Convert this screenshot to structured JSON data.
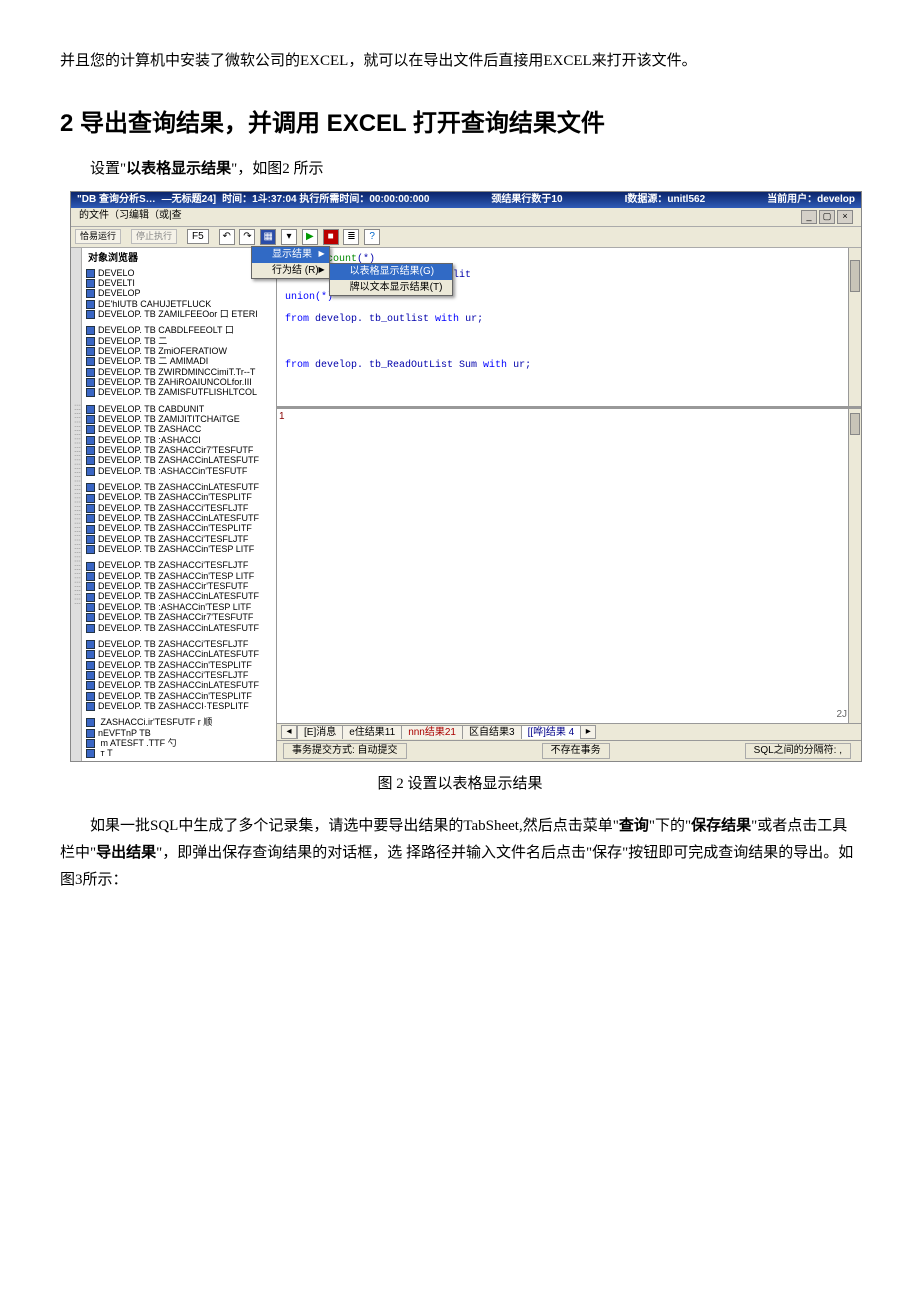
{
  "intro": "并且您的计算机中安装了微软公司的EXCEL，就可以在导出文件后直接用EXCEL来打开该文件。",
  "heading": "2 导出查询结果，并调用 EXCEL 打开查询结果文件",
  "lead_pre": "设置\"",
  "lead_bold": "以表格显示结果",
  "lead_post": "\"，如图2 所示",
  "figcap": "图 2 设置以表格显示结果",
  "outro_p1a": "如果一批SQL中生成了多个记录集，请选中要导出结果的TabSheet,然后点击菜单\"",
  "outro_b1": "查询",
  "outro_p1b": "\"下的\"",
  "outro_b2": "保存结果",
  "outro_p1c": "\"或者点击工具栏中\"",
  "outro_b3": "导出结果",
  "outro_p1d": "\"，即弹出保存查询结果的对话框，选 择路径并输入文件名后点击\"保存\"按钮即可完成查询结果的导出。如图3所示：",
  "titlebar": {
    "app": "\"DB 查询分析S…",
    "doc": "—无标题24]",
    "time": "时间：1斗:37:04 执行所需时间：00:00:00:000",
    "rows": "颈结果行数于10",
    "ds": "I数据源：unitl562",
    "user": "当前用户：develop"
  },
  "menubar": "的文件（习编辑（或|查",
  "toolbar": {
    "run": "恰易运行",
    "stop": "停止执行",
    "f5": "F5"
  },
  "objpane_title": "对象浏览器",
  "menu": {
    "m1": "显示结果",
    "m2": "行为结 (R)",
    "sub1": "以表格显示结果(G)",
    "sub2": "牌以文本显示结果(T)"
  },
  "sql": {
    "l1a": "select ",
    "l1b": "count",
    "l1c": "(*)",
    "l2": "from develop.tb_outlistforsplit",
    "l3": "union(*)",
    "l4a": "from ",
    "l4b": "develop. tb_outlist ",
    "l4c": "with ",
    "l4d": "ur;",
    "l5a": "from ",
    "l5b": "develop. tb_ReadOutList Sum ",
    "l5c": "with ",
    "l5d": "ur;"
  },
  "objlist": [
    "DEVELO",
    "DEVELTI",
    "DEVELOP",
    "DE'hIUTB       CAHUJETFLUCK",
    "DEVELOP. TB  ZAMILFEEOor 口  ETERI",
    "DEVELOP. TB  CABDLFEEOLT 口",
    "DEVELOP. TB  二",
    "DEVELOP. TB  ZmiOFERATIOW",
    "DEVELOP. TB  二 AMIMADI",
    "DEVELOP. TB  ZWIRDMINCCimiT.Tr--T",
    "DEVELOP. TB  ZAHiROAIUNCOLfor.III",
    "DEVELOP. TB  ZAMISFUTFLISHLTCOL",
    "DEVELOP. TB  CABDUNIT",
    "DEVELOP. TB  ZAMIJITITCHAiTGE",
    "DEVELOP. TB  ZASHACC",
    "DEVELOP. TB  :ASHACCI",
    "DEVELOP. TB  ZASHACCir7'TESFUTF",
    "DEVELOP. TB  ZASHACCinLATESFUTF",
    "DEVELOP. TB  :ASHACCin'TESFUTF",
    "DEVELOP. TB  ZASHACCinLATESFUTF",
    "DEVELOP. TB  ZASHACCin'TESPLITF",
    "DEVELOP. TB  ZASHACCi'TESFLJTF",
    "DEVELOP. TB  ZASHACCinLATESFUTF",
    "DEVELOP. TB  ZASHACCin'TESPLITF",
    "DEVELOP. TB  ZASHACCi'TESFLJTF",
    "DEVELOP. TB  ZASHACCin'TESP LITF",
    "DEVELOP. TB  ZASHACCi'TESFLJTF",
    "DEVELOP. TB  ZASHACCin'TESP LITF",
    "DEVELOP. TB  ZASHACCir'TESFUTF",
    "DEVELOP. TB  ZASHACCinLATESFUTF",
    "DEVELOP. TB  :ASHACCin'TESP LITF",
    "DEVELOP. TB  ZASHACCir7'TESFUTF",
    "DEVELOP. TB  ZASHACCinLATESFUTF",
    "DEVELOP. TB  ZASHACCi'TESFLJTF",
    "DEVELOP. TB  ZASHACCinLATESFUTF",
    "DEVELOP. TB  ZASHACCin'TESPLITF",
    "DEVELOP. TB  ZASHACCi'TESFLJTF",
    "DEVELOP. TB  ZASHACCinLATESFUTF",
    "DEVELOP. TB  ZASHACCin'TESPLITF",
    "DEVELOP. TB  ZASHACCI·TESPLITF",
    "             ZASHACCi.ir'TESFUTF r 顺",
    "nEVFTnP TB",
    "             m ATESFT .TTF 勺",
    "             т T"
  ],
  "tabs": {
    "t1": "[E]消息",
    "t2": "e住结果11",
    "t3": "nnn结果21",
    "t4": "区自结果3",
    "t5": "[[哗]结果 4"
  },
  "status": {
    "s1": "事务提交方式: 自动提交",
    "s2": "不存在事务",
    "s3": "SQL之间的分隔符: ,"
  },
  "rownum_marker": "1",
  "tail_marker": "2J"
}
